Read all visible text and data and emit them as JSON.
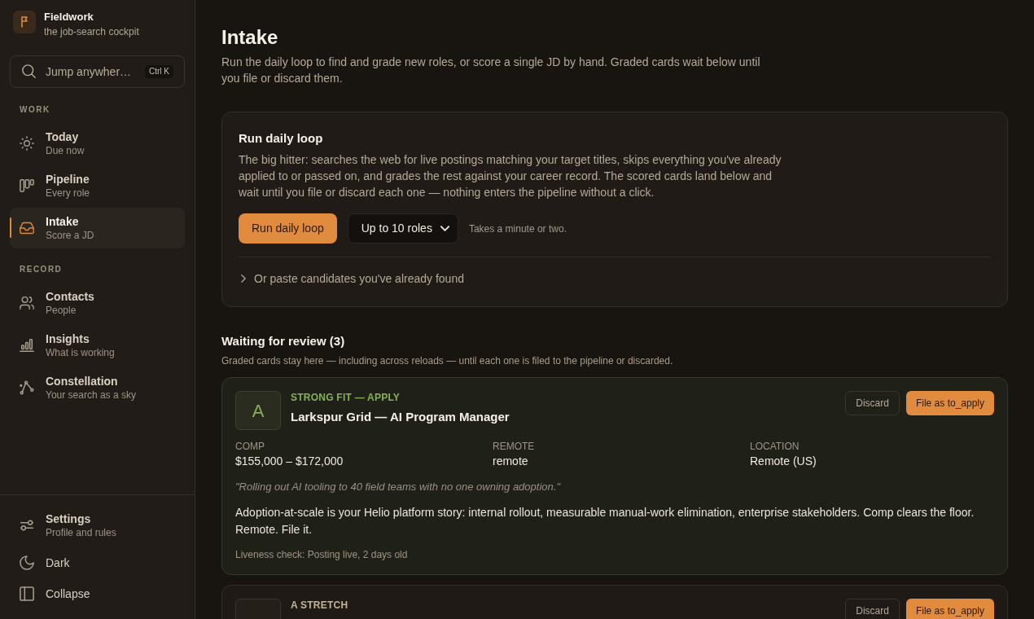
{
  "sidebar": {
    "brand": {
      "name": "Fieldwork",
      "tagline": "the job-search cockpit"
    },
    "search": {
      "placeholder": "Jump anywher…",
      "shortcut": "Ctrl K"
    },
    "sections": [
      {
        "label": "WORK",
        "items": [
          {
            "label": "Today",
            "sub": "Due now",
            "selected": false
          },
          {
            "label": "Pipeline",
            "sub": "Every role",
            "selected": false
          },
          {
            "label": "Intake",
            "sub": "Score a JD",
            "selected": true
          }
        ]
      },
      {
        "label": "RECORD",
        "items": [
          {
            "label": "Contacts",
            "sub": "People",
            "selected": false
          },
          {
            "label": "Insights",
            "sub": "What is working",
            "selected": false
          },
          {
            "label": "Constellation",
            "sub": "Your search as a sky",
            "selected": false
          }
        ]
      }
    ],
    "footer": [
      {
        "label": "Settings",
        "sub": "Profile and rules"
      },
      {
        "label": "Dark"
      },
      {
        "label": "Collapse"
      }
    ]
  },
  "page": {
    "title": "Intake",
    "description": "Run the daily loop to find and grade new roles, or score a single JD by hand. Graded cards wait below until you file or discard them."
  },
  "loop_panel": {
    "title": "Run daily loop",
    "description": "The big hitter: searches the web for live postings matching your target titles, skips everything you've already applied to or passed on, and grades the rest against your career record. The scored cards land below and wait until you file or discard each one — nothing enters the pipeline without a click.",
    "run_button": "Run daily loop",
    "limit_select": "Up to 10 roles",
    "hint": "Takes a minute or two.",
    "paste_toggle": {
      "label": "Or paste candidates you've already found",
      "expanded": false
    }
  },
  "review": {
    "title": "Waiting for review (3)",
    "note": "Graded cards stay here — including across reloads — until each one is filed to the pipeline or discarded.",
    "cards": [
      {
        "kind": "strong",
        "grade": "A",
        "verdict": "STRONG FIT — APPLY",
        "title": "Larkspur Grid — AI Program Manager",
        "actions": [
          {
            "label": "Discard",
            "kind": "secondary"
          },
          {
            "label": "File as to_apply",
            "kind": "primary"
          }
        ],
        "fields": [
          {
            "label": "COMP",
            "value": "$155,000 – $172,000"
          },
          {
            "label": "REMOTE",
            "value": "remote"
          },
          {
            "label": "LOCATION",
            "value": "Remote (US)"
          }
        ],
        "quote": "\"Rolling out AI tooling to 40 field teams with no one owning adoption.\"",
        "summary": "Adoption-at-scale is your Helio platform story: internal rollout, measurable manual-work elimination, enterprise stakeholders. Comp clears the floor. Remote. File it.",
        "liveness": "Liveness check: Posting live, 2 days old"
      },
      {
        "kind": "stretch",
        "verdict": "A STRETCH",
        "actions": [
          {
            "label": "Discard",
            "kind": "secondary"
          },
          {
            "label": "File as to_apply",
            "kind": "primary"
          }
        ]
      }
    ]
  }
}
